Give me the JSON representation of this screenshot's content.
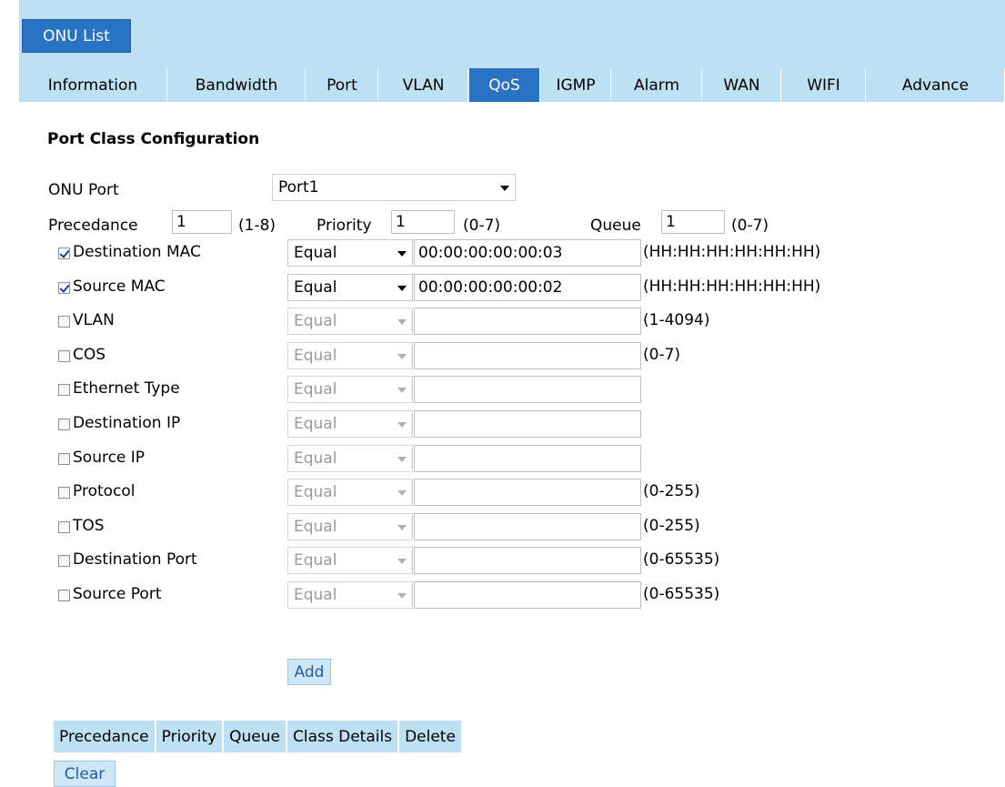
{
  "top_tab": {
    "label": "ONU List"
  },
  "sub_tabs": [
    {
      "label": "Information",
      "active": false
    },
    {
      "label": "Bandwidth",
      "active": false
    },
    {
      "label": "Port",
      "active": false
    },
    {
      "label": "VLAN",
      "active": false
    },
    {
      "label": "QoS",
      "active": true
    },
    {
      "label": "IGMP",
      "active": false
    },
    {
      "label": "Alarm",
      "active": false
    },
    {
      "label": "WAN",
      "active": false
    },
    {
      "label": "WIFI",
      "active": false
    },
    {
      "label": "Advance",
      "active": false
    }
  ],
  "section": {
    "title": "Port Class Configuration"
  },
  "onu_port": {
    "label": "ONU Port",
    "value": "Port1"
  },
  "precedance": {
    "label": "Precedance",
    "value": "1",
    "range": "(1-8)"
  },
  "priority": {
    "label": "Priority",
    "value": "1",
    "range": "(0-7)"
  },
  "queue": {
    "label": "Queue",
    "value": "1",
    "range": "(0-7)"
  },
  "rules": [
    {
      "label": "Destination MAC",
      "checked": true,
      "operator": "Equal",
      "value": "00:00:00:00:00:03",
      "hint": "(HH:HH:HH:HH:HH:HH)"
    },
    {
      "label": "Source MAC",
      "checked": true,
      "operator": "Equal",
      "value": "00:00:00:00:00:02",
      "hint": "(HH:HH:HH:HH:HH:HH)"
    },
    {
      "label": "VLAN",
      "checked": false,
      "operator": "Equal",
      "value": "",
      "hint": "(1-4094)"
    },
    {
      "label": "COS",
      "checked": false,
      "operator": "Equal",
      "value": "",
      "hint": "(0-7)"
    },
    {
      "label": "Ethernet Type",
      "checked": false,
      "operator": "Equal",
      "value": "",
      "hint": ""
    },
    {
      "label": "Destination IP",
      "checked": false,
      "operator": "Equal",
      "value": "",
      "hint": ""
    },
    {
      "label": "Source IP",
      "checked": false,
      "operator": "Equal",
      "value": "",
      "hint": ""
    },
    {
      "label": "Protocol",
      "checked": false,
      "operator": "Equal",
      "value": "",
      "hint": "(0-255)"
    },
    {
      "label": "TOS",
      "checked": false,
      "operator": "Equal",
      "value": "",
      "hint": "(0-255)"
    },
    {
      "label": "Destination Port",
      "checked": false,
      "operator": "Equal",
      "value": "",
      "hint": "(0-65535)"
    },
    {
      "label": "Source Port",
      "checked": false,
      "operator": "Equal",
      "value": "",
      "hint": "(0-65535)"
    }
  ],
  "buttons": {
    "add": "Add",
    "clear": "Clear"
  },
  "class_table": {
    "headers": [
      "Precedance",
      "Priority",
      "Queue",
      "Class Details",
      "Delete"
    ]
  }
}
